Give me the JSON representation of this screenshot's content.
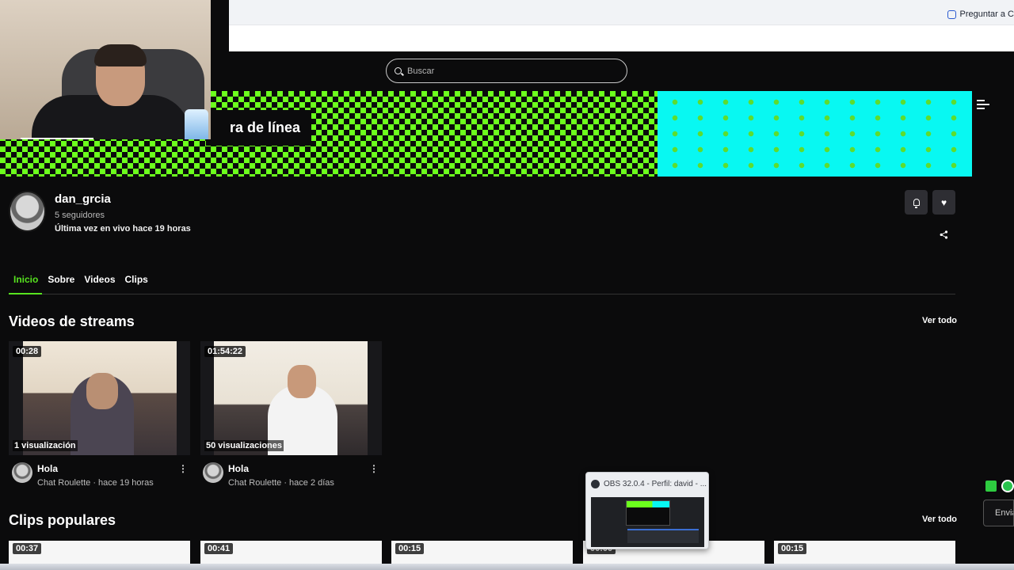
{
  "browser": {
    "ask_button": "Preguntar a C"
  },
  "search": {
    "placeholder": "Buscar"
  },
  "banner": {
    "label": "ra de línea"
  },
  "channel": {
    "name": "dan_grcia",
    "followers": "5 seguidores",
    "last_live": "Última vez en vivo hace 19 horas"
  },
  "tabs": [
    {
      "label": "Inicio",
      "active": true
    },
    {
      "label": "Sobre",
      "active": false
    },
    {
      "label": "Videos",
      "active": false
    },
    {
      "label": "Clips",
      "active": false
    }
  ],
  "videos_section": {
    "title": "Videos de streams",
    "see_all": "Ver todo",
    "items": [
      {
        "duration": "00:28",
        "views": "1 visualización",
        "title": "Hola",
        "category": "Chat Roulette",
        "time": "hace 19 horas"
      },
      {
        "duration": "01:54:22",
        "views": "50 visualizaciones",
        "title": "Hola",
        "category": "Chat Roulette",
        "time": "hace 2 días"
      }
    ]
  },
  "clips_section": {
    "title": "Clips populares",
    "see_all": "Ver todo",
    "items": [
      {
        "duration": "00:37"
      },
      {
        "duration": "00:41"
      },
      {
        "duration": "00:15"
      },
      {
        "duration": "00:00"
      },
      {
        "duration": "00:15"
      }
    ]
  },
  "obs_popup": {
    "title": "OBS 32.0.4 - Perfil: david - ..."
  },
  "chat": {
    "send_label": "Envia"
  },
  "colors": {
    "accent": "#57e31f",
    "banner_green": "#6cff1d",
    "banner_cyan": "#08f8f2",
    "background": "#0b0b0c"
  },
  "icons": [
    "search-icon",
    "collapse-icon",
    "bell-icon",
    "heart-icon",
    "share-icon",
    "kebab-icon",
    "obs-icon"
  ]
}
